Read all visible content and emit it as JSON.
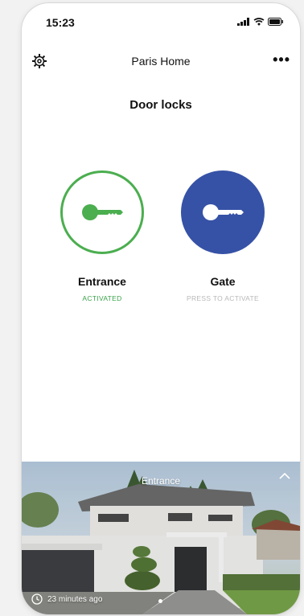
{
  "status_bar": {
    "time": "15:23"
  },
  "nav": {
    "title": "Paris Home",
    "more_label": "•••"
  },
  "section": {
    "title": "Door locks"
  },
  "locks": [
    {
      "name": "Entrance",
      "status": "ACTIVATED",
      "icon": "key-icon",
      "color": "#4bae4f"
    },
    {
      "name": "Gate",
      "status": "PRESS TO ACTIVATE",
      "icon": "key-icon",
      "color": "#3652a6"
    }
  ],
  "camera": {
    "label": "Entrance",
    "timestamp": "23 minutes ago"
  }
}
